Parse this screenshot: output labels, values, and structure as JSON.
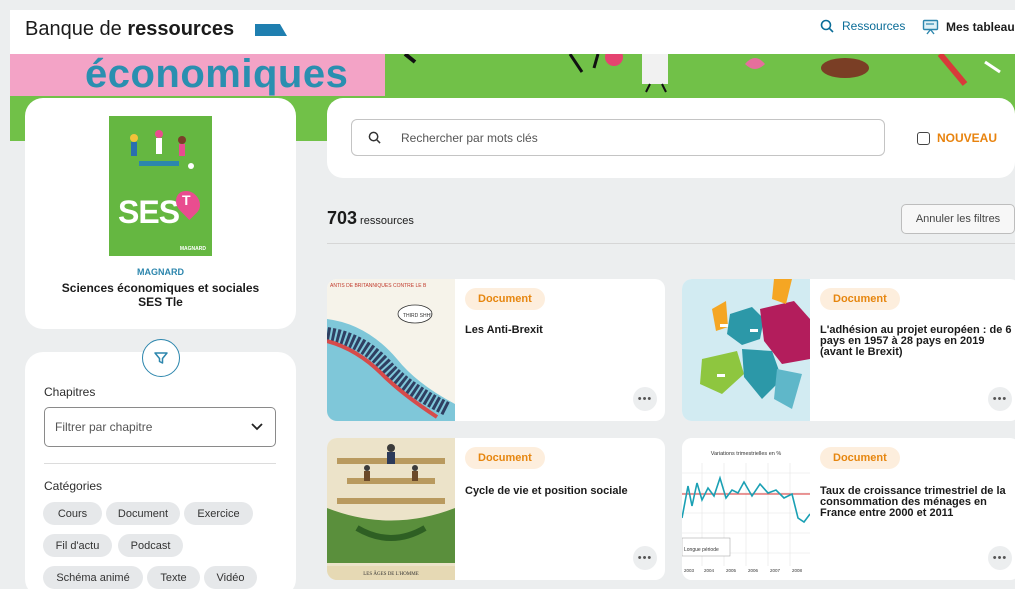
{
  "header": {
    "brand_light": "Banque de",
    "brand_bold": "ressources",
    "nav_resources": "Ressources",
    "nav_boards": "Mes tableaux"
  },
  "banner": {
    "title": "économiques"
  },
  "book": {
    "publisher": "MAGNARD",
    "title_line1": "Sciences économiques et sociales",
    "title_line2": "SES Tle",
    "cover_text": "SES",
    "cover_grade": "T",
    "cover_publisher": "MAGNARD"
  },
  "filters": {
    "chapters_label": "Chapitres",
    "chapter_placeholder": "Filtrer par chapitre",
    "categories_label": "Catégories",
    "categories": [
      "Cours",
      "Document",
      "Exercice",
      "Fil d'actu",
      "Podcast",
      "Schéma animé",
      "Texte",
      "Vidéo"
    ]
  },
  "search": {
    "placeholder": "Rechercher par mots clés",
    "new_label": "NOUVEAU"
  },
  "results": {
    "count": "703",
    "count_label": "ressources",
    "reset_label": "Annuler les filtres"
  },
  "cards": [
    {
      "tag": "Document",
      "title": "Les Anti-Brexit",
      "image_caption": "ANTIS DE BRITANNIQUES CONTRE LE B",
      "speech": "THIRD SHH!"
    },
    {
      "tag": "Document",
      "title": "L'adhésion au projet européen : de 6 pays en 1957 à 28 pays en 2019 (avant le Brexit)"
    },
    {
      "tag": "Document",
      "title": "Cycle de vie et position sociale",
      "image_caption": "LES ÂGES DE L'HOMME"
    },
    {
      "tag": "Document",
      "title": "Taux de croissance trimestriel de la consommation des ménages en France entre 2000 et 2011",
      "image_caption": "Variations trimestrielles en %",
      "image_legend": "Longue période",
      "image_years": [
        "2003",
        "2004",
        "2005",
        "2006",
        "2007",
        "2008"
      ]
    }
  ],
  "more_symbol": "•••",
  "colors": {
    "accent": "#2c86ad",
    "tag": "#e6860f",
    "banner_green": "#71c148",
    "banner_pink": "#f3a3c6"
  }
}
